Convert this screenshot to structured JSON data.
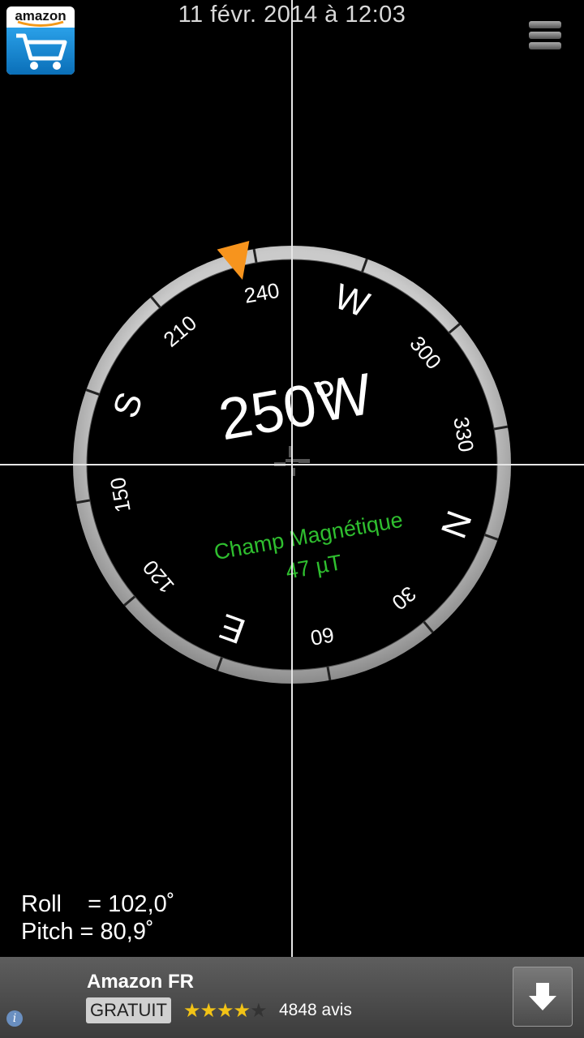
{
  "header": {
    "datetime": "11 févr. 2014 à 12:03",
    "camera_icon": "camera-icon",
    "menu_icon": "hamburger-menu-icon"
  },
  "compass": {
    "heading_deg": 250,
    "heading_text": "250°",
    "heading_direction": "W",
    "cardinals": {
      "N": "N",
      "E": "E",
      "S": "S",
      "W": "W"
    },
    "degree_labels": [
      "30",
      "60",
      "120",
      "150",
      "210",
      "240",
      "300",
      "330"
    ],
    "field_label": "Champ Magnétique",
    "field_value": "47 µT",
    "field_color": "#2fbf2f",
    "marker_color": "#f7941d"
  },
  "readouts": {
    "roll": "Roll    = 102,0˚",
    "pitch": "Pitch = 80,9˚"
  },
  "ad": {
    "icon_brand": "amazon",
    "title": "Amazon FR",
    "badge": "GRATUIT",
    "rating_stars": 4,
    "rating_max": 5,
    "reviews": "4848 avis",
    "download_icon": "download-arrow-icon",
    "info_icon": "info-icon"
  }
}
